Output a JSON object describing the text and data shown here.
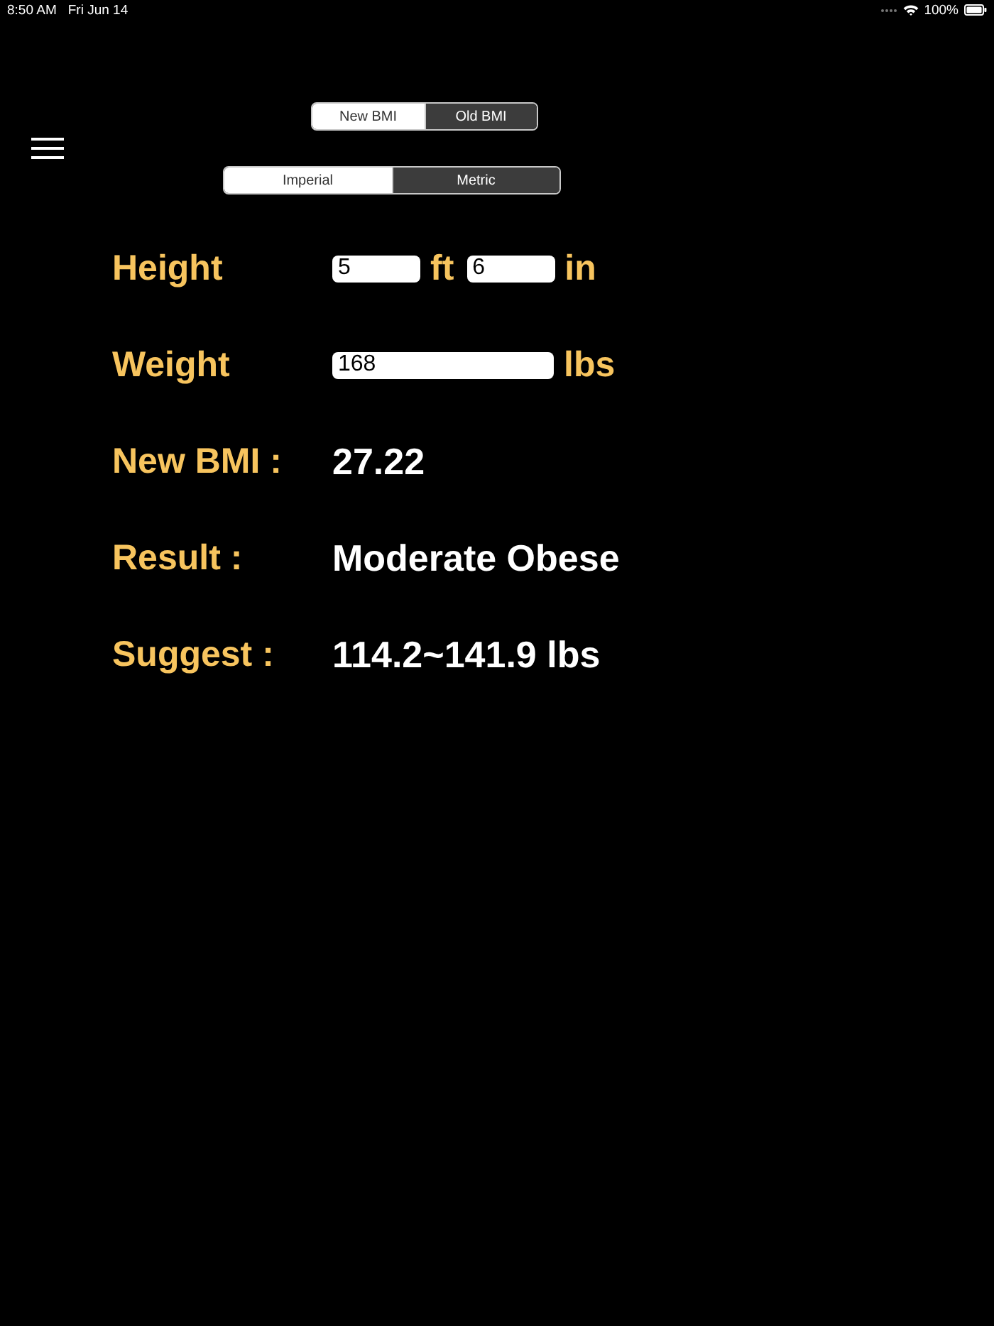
{
  "status_bar": {
    "time": "8:50 AM",
    "date": "Fri Jun 14",
    "battery": "100%"
  },
  "bmi_mode": [
    {
      "label": "New BMI",
      "selected": true
    },
    {
      "label": "Old BMI",
      "selected": false
    }
  ],
  "units": [
    {
      "label": "Imperial",
      "selected": true
    },
    {
      "label": "Metric",
      "selected": false
    }
  ],
  "inputs": [
    {
      "label": "Height",
      "fields": [
        {
          "value": "5",
          "unit": "ft"
        },
        {
          "value": "6",
          "unit": "in"
        }
      ]
    },
    {
      "label": "Weight",
      "fields": [
        {
          "value": "168",
          "unit": "lbs"
        }
      ]
    }
  ],
  "results": [
    {
      "label": "New BMI :",
      "value": "27.22"
    },
    {
      "label": "Result :",
      "value": "Moderate Obese"
    },
    {
      "label": "Suggest :",
      "value": "114.2~141.9 lbs"
    }
  ]
}
